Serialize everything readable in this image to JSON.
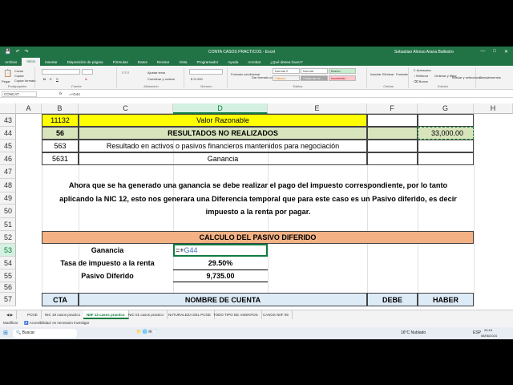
{
  "window": {
    "title": "CONTA CASOS PRACTICOS  -  Excel",
    "user": "Sebastian Alonso Arana Ballestro",
    "user_initials": "SA"
  },
  "menu": [
    "Archivo",
    "Inicio",
    "Insertar",
    "Disposición de página",
    "Fórmulas",
    "Datos",
    "Revisar",
    "Vista",
    "Programador",
    "Ayuda",
    "Acrobat",
    "¿Qué desea hacer?"
  ],
  "ribbon": {
    "portapapeles": "Portapapeles",
    "pegar": "Pegar",
    "cortar": "Cortar",
    "copiar": "Copiar",
    "copiar_formato": "Copiar formato",
    "fuente": "Fuente",
    "alineacion": "Alineación",
    "ajustar_texto": "Ajustar texto",
    "combinar": "Combinar y centrar",
    "numero": "Número",
    "estilos": "Estilos",
    "formato_condicional": "Formato condicional",
    "dar_formato": "Dar formato como tabla",
    "style_normal2": "Normal 2",
    "style_normal": "Normal",
    "style_bueno": "Bueno",
    "style_calculo": "Cálculo",
    "style_celda": "Celda de co...",
    "style_incorrecto": "Incorrecto",
    "celdas": "Celdas",
    "insertar": "Insertar",
    "eliminar": "Eliminar",
    "formato": "Formato",
    "edicion": "Edición",
    "autosuma": "Autosuma",
    "rellenar": "Rellenar",
    "borrar": "Borrar",
    "ordenar": "Ordenar y filtrar",
    "buscar": "Buscar y seleccionar",
    "complementos": "Complementos"
  },
  "formula_bar": {
    "name_box": "CONCAT",
    "formula": "=+G44"
  },
  "columns": [
    "A",
    "B",
    "C",
    "D",
    "E",
    "F",
    "G",
    "H"
  ],
  "rows": [
    "43",
    "44",
    "45",
    "46",
    "47",
    "48",
    "49",
    "50",
    "51",
    "52",
    "53",
    "54",
    "55",
    "56",
    "57"
  ],
  "cells": {
    "b43": "11132",
    "c43": "Valor Razonable",
    "b44": "56",
    "c44": "RESULTADOS NO REALIZADOS",
    "g44": "33,000.00",
    "b45": "563",
    "c45": "Resultado en activos o pasivos financieros mantenidos para negociación",
    "b46": "5631",
    "c46": "Ganancia",
    "para1": "Ahora que se ha generado una ganancia se debe realizar el pago del impuesto correspondiente, por lo tanto",
    "para2": "aplicando la NIC 12, esto nos generara una Diferencia temporal que para este caso es un Pasivo diferido, es decir",
    "para3": "impuesto a la renta por pagar.",
    "calc_title": "CALCULO DEL PASIVO DIFERIDO",
    "ganancia_label": "Ganancia",
    "ganancia_edit": "=+G44",
    "tasa_label": "Tasa de impuesto a la renta",
    "tasa_value": "29.50%",
    "pasivo_label": "Pasivo Diferido",
    "pasivo_value": "9,735.00",
    "h_cta": "CTA",
    "h_nombre": "NOMBRE DE CUENTA",
    "h_debe": "DEBE",
    "h_haber": "HABER"
  },
  "tabs": [
    "PCGE",
    "NIC 19 casos practico",
    "NIIF 13 casos practico",
    "NIC 01 casos practico",
    "NATURALEZA DEL PCGE",
    "TODO TIPO DE ASIENTOS",
    "CASOS NIIF 09"
  ],
  "active_tab": "NIIF 13 casos practico",
  "status": {
    "mode": "Modificar",
    "accessibility": "Accesibilidad: es necesario investigar"
  },
  "taskbar": {
    "search": "Buscar",
    "weather": "16°C  Nublado",
    "lang": "ESP",
    "time": "20:15",
    "date": "08/06/2024"
  },
  "colors": {
    "excel_green": "#217346",
    "yellow": "#ffff00",
    "light_green": "#d8e4bc",
    "orange": "#f4b183",
    "light_blue": "#ddebf7"
  }
}
